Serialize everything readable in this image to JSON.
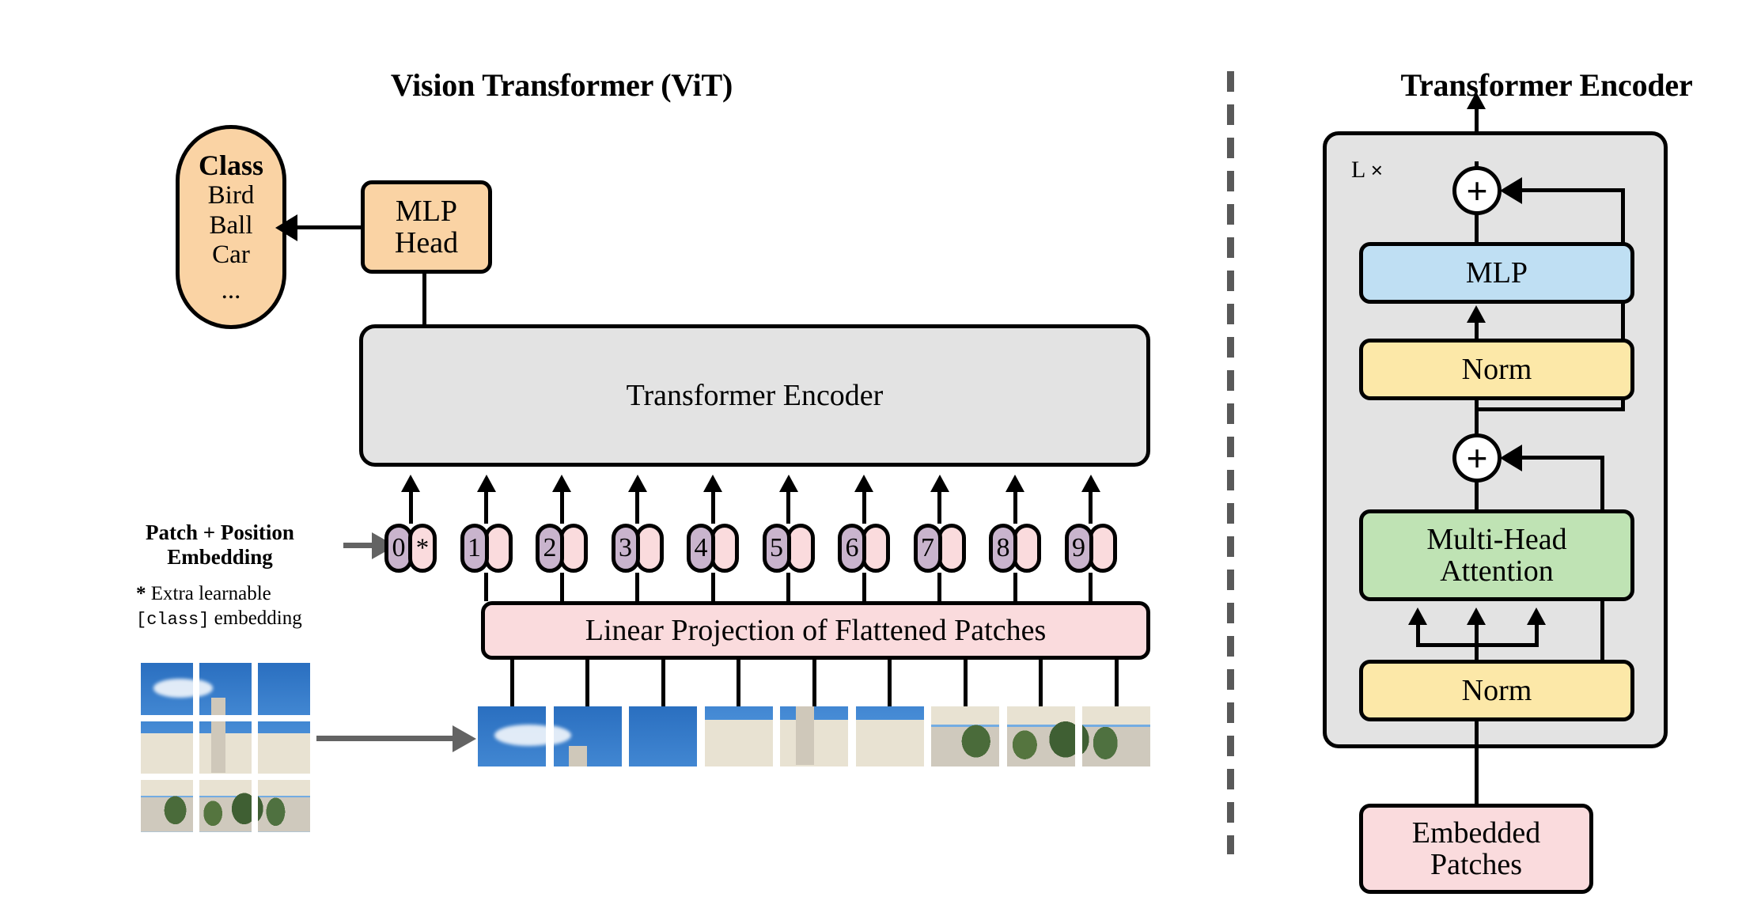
{
  "figure": {
    "left_title": "Vision Transformer (ViT)",
    "right_title": "Transformer Encoder"
  },
  "vit": {
    "class_head": {
      "header": "Class",
      "items": [
        "Bird",
        "Ball",
        "Car"
      ],
      "ellipsis": "..."
    },
    "mlp_head": {
      "line1": "MLP",
      "line2": "Head"
    },
    "encoder_block": {
      "label": "Transformer Encoder"
    },
    "linear_projection": {
      "label": "Linear Projection of Flattened Patches"
    },
    "embedding_label": {
      "line1": "Patch + Position",
      "line2": "Embedding"
    },
    "footnote": {
      "marker": "*",
      "line1": "Extra learnable",
      "token": "[class]",
      "line2_tail": " embedding"
    },
    "tokens": [
      {
        "index": "0",
        "embedding_marker": "*"
      },
      {
        "index": "1",
        "embedding_marker": ""
      },
      {
        "index": "2",
        "embedding_marker": ""
      },
      {
        "index": "3",
        "embedding_marker": ""
      },
      {
        "index": "4",
        "embedding_marker": ""
      },
      {
        "index": "5",
        "embedding_marker": ""
      },
      {
        "index": "6",
        "embedding_marker": ""
      },
      {
        "index": "7",
        "embedding_marker": ""
      },
      {
        "index": "8",
        "embedding_marker": ""
      },
      {
        "index": "9",
        "embedding_marker": ""
      }
    ],
    "input_image": {
      "grid_rows": 3,
      "grid_cols": 3,
      "patch_count": 9
    }
  },
  "encoder": {
    "repeat_label": "L",
    "repeat_times_symbol": "×",
    "blocks": {
      "mlp": "MLP",
      "norm_top": "Norm",
      "attention_line1": "Multi-Head",
      "attention_line2": "Attention",
      "norm_bottom": "Norm",
      "embedded_patches_line1": "Embedded",
      "embedded_patches_line2": "Patches"
    },
    "residual_symbol": "+"
  },
  "colors": {
    "orange": "#fad3a4",
    "grey": "#e3e3e3",
    "pink": "#fadbdd",
    "blue": "#bfdff3",
    "yellow": "#fce8a8",
    "green": "#bfe3b4",
    "purple": "#c9b4cd",
    "stroke": "#000000",
    "divider": "#595959",
    "grey_arrow": "#636363"
  }
}
